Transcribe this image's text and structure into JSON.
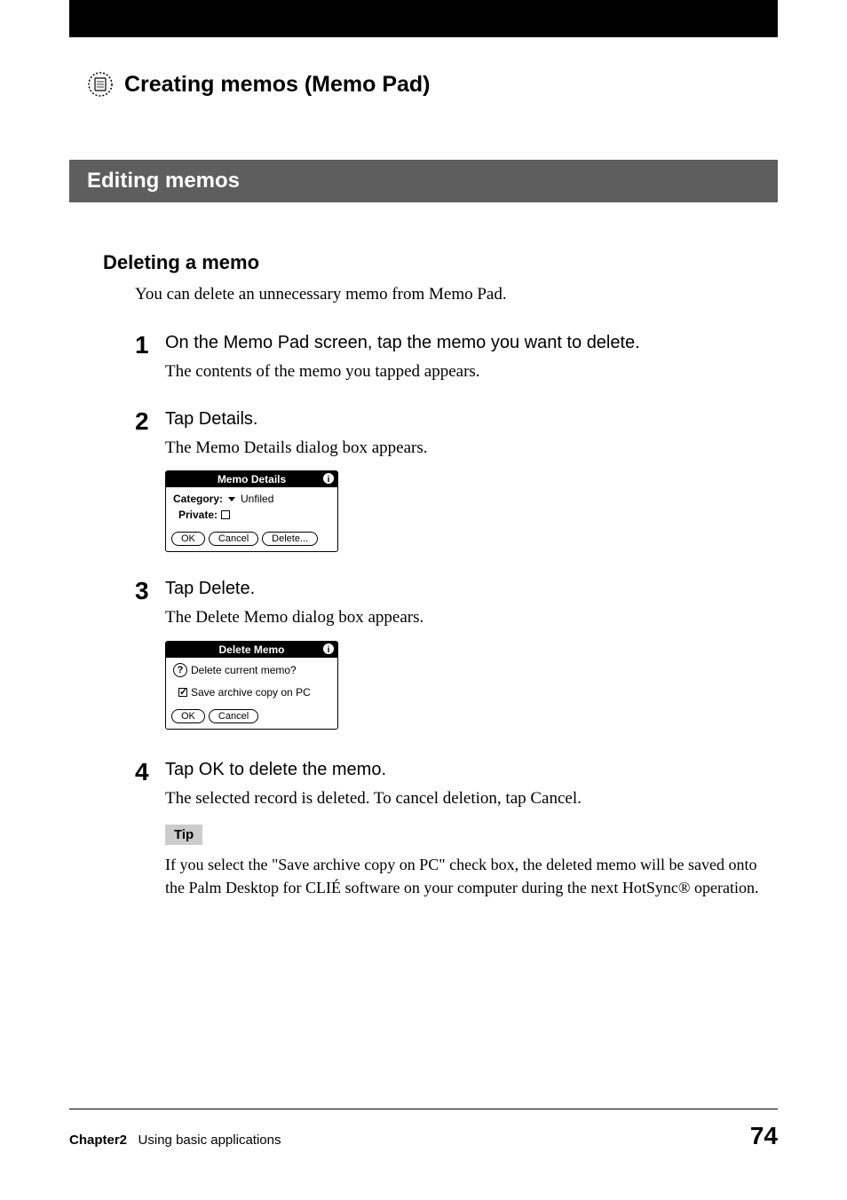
{
  "page": {
    "title": "Creating memos (Memo Pad)",
    "section": "Editing memos",
    "subheading": "Deleting a memo",
    "intro": "You can delete an unnecessary memo from Memo Pad.",
    "steps": [
      {
        "num": "1",
        "title": "On the Memo Pad screen, tap the memo you want to delete.",
        "desc": "The contents of the memo you tapped appears."
      },
      {
        "num": "2",
        "title": "Tap Details.",
        "desc": "The Memo Details dialog box appears."
      },
      {
        "num": "3",
        "title": "Tap Delete.",
        "desc": "The Delete Memo dialog box appears."
      },
      {
        "num": "4",
        "title": "Tap OK to delete the memo.",
        "desc": "The selected record is deleted. To cancel deletion, tap Cancel."
      }
    ],
    "dialog1": {
      "title": "Memo Details",
      "category_label": "Category:",
      "category_value": "Unfiled",
      "private_label": "Private:",
      "ok": "OK",
      "cancel": "Cancel",
      "delete": "Delete..."
    },
    "dialog2": {
      "title": "Delete Memo",
      "question": "Delete current memo?",
      "archive": "Save archive copy on PC",
      "ok": "OK",
      "cancel": "Cancel"
    },
    "tip_label": "Tip",
    "tip_text": "If you select the \"Save archive copy on PC\" check box, the deleted memo will be saved onto the Palm Desktop for CLIÉ software on your computer during the next HotSync® operation.",
    "footer": {
      "chapter": "Chapter2",
      "chapter_text": "Using basic applications",
      "page": "74"
    }
  }
}
